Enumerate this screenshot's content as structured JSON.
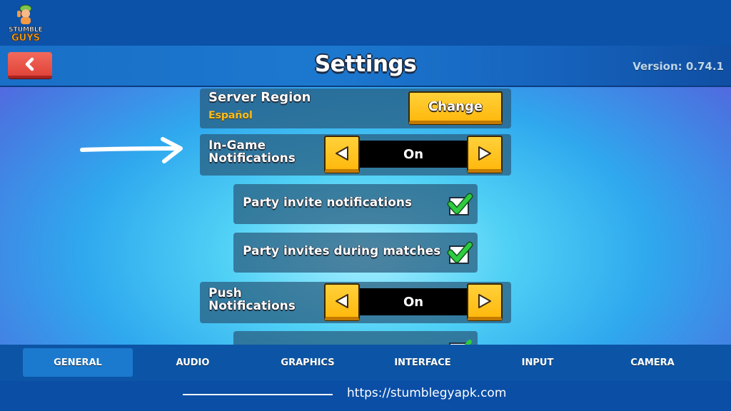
{
  "brand": {
    "logo_line1": "STUMBLE",
    "logo_line2": "GUYS"
  },
  "header": {
    "title": "Settings",
    "version": "Version: 0.74.1",
    "back_icon": "chevron-left-icon"
  },
  "settings": {
    "server_region": {
      "label": "Server Region",
      "value": "Español",
      "button_label": "Change"
    },
    "in_game_notifications": {
      "label_line1": "In-Game",
      "label_line2": "Notifications",
      "value": "On"
    },
    "party_invite_notifications": {
      "label": "Party invite notifications",
      "checked": true
    },
    "party_invites_during_matches": {
      "label": "Party invites during matches",
      "checked": true
    },
    "push_notifications": {
      "label_line1": "Push",
      "label_line2": "Notifications",
      "value": "On"
    }
  },
  "tabs": [
    {
      "label": "GENERAL",
      "active": true
    },
    {
      "label": "AUDIO",
      "active": false
    },
    {
      "label": "GRAPHICS",
      "active": false
    },
    {
      "label": "INTERFACE",
      "active": false
    },
    {
      "label": "INPUT",
      "active": false
    },
    {
      "label": "CAMERA",
      "active": false
    }
  ],
  "footer": {
    "url": "https://stumblegyapk.com"
  },
  "colors": {
    "accent_yellow": "#ffbd1a",
    "back_red": "#e0443b",
    "check_green": "#2ecc40",
    "active_tab": "#1b7ace"
  }
}
